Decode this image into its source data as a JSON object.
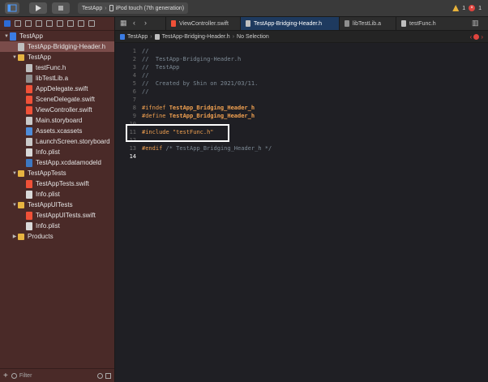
{
  "toolbar": {
    "scheme_target": "TestApp",
    "scheme_device": "iPod touch (7th generation)",
    "warnings": "1",
    "errors": "1"
  },
  "navigator": {
    "filter_placeholder": "Filter",
    "tree": [
      {
        "label": "TestApp",
        "icon": "project-icon",
        "type": "proj",
        "indent": 0,
        "disclosure": "down"
      },
      {
        "label": "TestApp-Bridging-Header.h",
        "icon": "header-file-icon",
        "type": "h",
        "indent": 1,
        "selected": true
      },
      {
        "label": "TestApp",
        "icon": "folder-icon",
        "type": "folder",
        "indent": 1,
        "disclosure": "down"
      },
      {
        "label": "testFunc.h",
        "icon": "header-file-icon",
        "type": "h",
        "indent": 2
      },
      {
        "label": "libTestLib.a",
        "icon": "library-file-icon",
        "type": "a",
        "indent": 2
      },
      {
        "label": "AppDelegate.swift",
        "icon": "swift-file-icon",
        "type": "swift",
        "indent": 2
      },
      {
        "label": "SceneDelegate.swift",
        "icon": "swift-file-icon",
        "type": "swift",
        "indent": 2
      },
      {
        "label": "ViewController.swift",
        "icon": "swift-file-icon",
        "type": "swift",
        "indent": 2
      },
      {
        "label": "Main.storyboard",
        "icon": "storyboard-file-icon",
        "type": "sb",
        "indent": 2
      },
      {
        "label": "Assets.xcassets",
        "icon": "asset-catalog-icon",
        "type": "xcassets",
        "indent": 2
      },
      {
        "label": "LaunchScreen.storyboard",
        "icon": "storyboard-file-icon",
        "type": "sb",
        "indent": 2
      },
      {
        "label": "Info.plist",
        "icon": "plist-file-icon",
        "type": "plist",
        "indent": 2
      },
      {
        "label": "TestApp.xcdatamodeld",
        "icon": "datamodel-file-icon",
        "type": "model",
        "indent": 2
      },
      {
        "label": "TestAppTests",
        "icon": "folder-icon",
        "type": "folder",
        "indent": 1,
        "disclosure": "down"
      },
      {
        "label": "TestAppTests.swift",
        "icon": "swift-file-icon",
        "type": "swift",
        "indent": 2
      },
      {
        "label": "Info.plist",
        "icon": "plist-file-icon",
        "type": "plist",
        "indent": 2
      },
      {
        "label": "TestAppUITests",
        "icon": "folder-icon",
        "type": "folder",
        "indent": 1,
        "disclosure": "down"
      },
      {
        "label": "TestAppUITests.swift",
        "icon": "swift-file-icon",
        "type": "swift",
        "indent": 2
      },
      {
        "label": "Info.plist",
        "icon": "plist-file-icon",
        "type": "plist",
        "indent": 2
      },
      {
        "label": "Products",
        "icon": "folder-icon",
        "type": "folder",
        "indent": 1,
        "disclosure": "right"
      }
    ]
  },
  "tabs": [
    {
      "label": "ViewController.swift",
      "icon": "swift-file-icon",
      "type": "swift",
      "active": false
    },
    {
      "label": "TestApp-Bridging-Header.h",
      "icon": "header-file-icon",
      "type": "h",
      "active": true
    },
    {
      "label": "libTestLib.a",
      "icon": "library-file-icon",
      "type": "a",
      "active": false
    },
    {
      "label": "testFunc.h",
      "icon": "header-file-icon",
      "type": "h",
      "active": false
    }
  ],
  "jumpbar": {
    "project": "TestApp",
    "file": "TestApp-Bridging-Header.h",
    "selection": "No Selection"
  },
  "editor": {
    "current_line": 14,
    "lines": [
      {
        "n": "1",
        "segments": [
          {
            "t": "//",
            "c": "comment"
          }
        ]
      },
      {
        "n": "2",
        "segments": [
          {
            "t": "//  TestApp-Bridging-Header.h",
            "c": "comment"
          }
        ]
      },
      {
        "n": "3",
        "segments": [
          {
            "t": "//  TestApp",
            "c": "comment"
          }
        ]
      },
      {
        "n": "4",
        "segments": [
          {
            "t": "//",
            "c": "comment"
          }
        ]
      },
      {
        "n": "5",
        "segments": [
          {
            "t": "//  Created by Shin on 2021/03/11.",
            "c": "comment"
          }
        ]
      },
      {
        "n": "6",
        "segments": [
          {
            "t": "//",
            "c": "comment"
          }
        ]
      },
      {
        "n": "7",
        "segments": []
      },
      {
        "n": "8",
        "segments": [
          {
            "t": "#ifndef ",
            "c": "prep"
          },
          {
            "t": "TestApp_Bridging_Header_h",
            "c": "ident"
          }
        ]
      },
      {
        "n": "9",
        "segments": [
          {
            "t": "#define ",
            "c": "prep"
          },
          {
            "t": "TestApp_Bridging_Header_h",
            "c": "ident"
          }
        ]
      },
      {
        "n": "10",
        "segments": []
      },
      {
        "n": "11",
        "segments": [
          {
            "t": "#include ",
            "c": "prep"
          },
          {
            "t": "\"testFunc.h\"",
            "c": "str"
          }
        ]
      },
      {
        "n": "12",
        "segments": []
      },
      {
        "n": "13",
        "segments": [
          {
            "t": "#endif ",
            "c": "prep"
          },
          {
            "t": "/* TestApp_Bridging_Header_h */",
            "c": "comment"
          }
        ]
      },
      {
        "n": "14",
        "segments": []
      }
    ]
  }
}
